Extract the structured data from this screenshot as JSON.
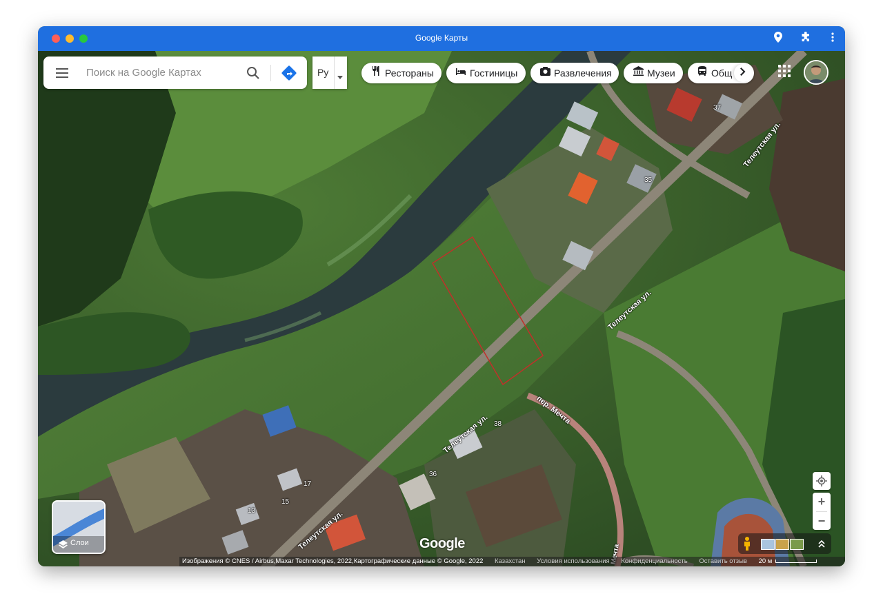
{
  "window": {
    "title": "Google Карты",
    "traffic_lights": [
      "#ff5f57",
      "#febc2e",
      "#28c840"
    ],
    "toolbar_icons": [
      "map-pin-icon",
      "puzzle-icon",
      "kebab-menu-icon"
    ]
  },
  "search": {
    "placeholder": "Поиск на Google Картах",
    "icons": [
      "menu-icon",
      "search-icon",
      "directions-icon"
    ]
  },
  "language": {
    "label": "Ру"
  },
  "chips": [
    {
      "label": "Рестораны",
      "icon": "fork-knife-icon"
    },
    {
      "label": "Гостиницы",
      "icon": "bed-icon"
    },
    {
      "label": "Развлечения",
      "icon": "camera-icon"
    },
    {
      "label": "Музеи",
      "icon": "museum-icon"
    },
    {
      "label": "Общ",
      "icon": "transit-icon"
    }
  ],
  "map": {
    "road_labels": [
      {
        "text": "Телеутская ул."
      },
      {
        "text": "Телеутская ул."
      },
      {
        "text": "Телеутская ул."
      },
      {
        "text": "Телеутская ул."
      },
      {
        "text": "пер. Мечта"
      },
      {
        "text": "Мечта"
      }
    ],
    "house_numbers": [
      "37",
      "35",
      "38",
      "36",
      "17",
      "15",
      "13"
    ],
    "plot_outline_color": "#c0302a"
  },
  "layers": {
    "label": "Слои"
  },
  "logo": "Google",
  "attribution": {
    "imagery": "Изображения © CNES / Airbus,Maxar Technologies, 2022,Картографические данные © Google, 2022",
    "country": "Казахстан",
    "terms": "Условия использования",
    "privacy": "Конфиденциальность",
    "feedback": "Оставить отзыв",
    "scale": "20 м"
  },
  "controls": {
    "zoom_in": "+",
    "zoom_out": "−"
  }
}
